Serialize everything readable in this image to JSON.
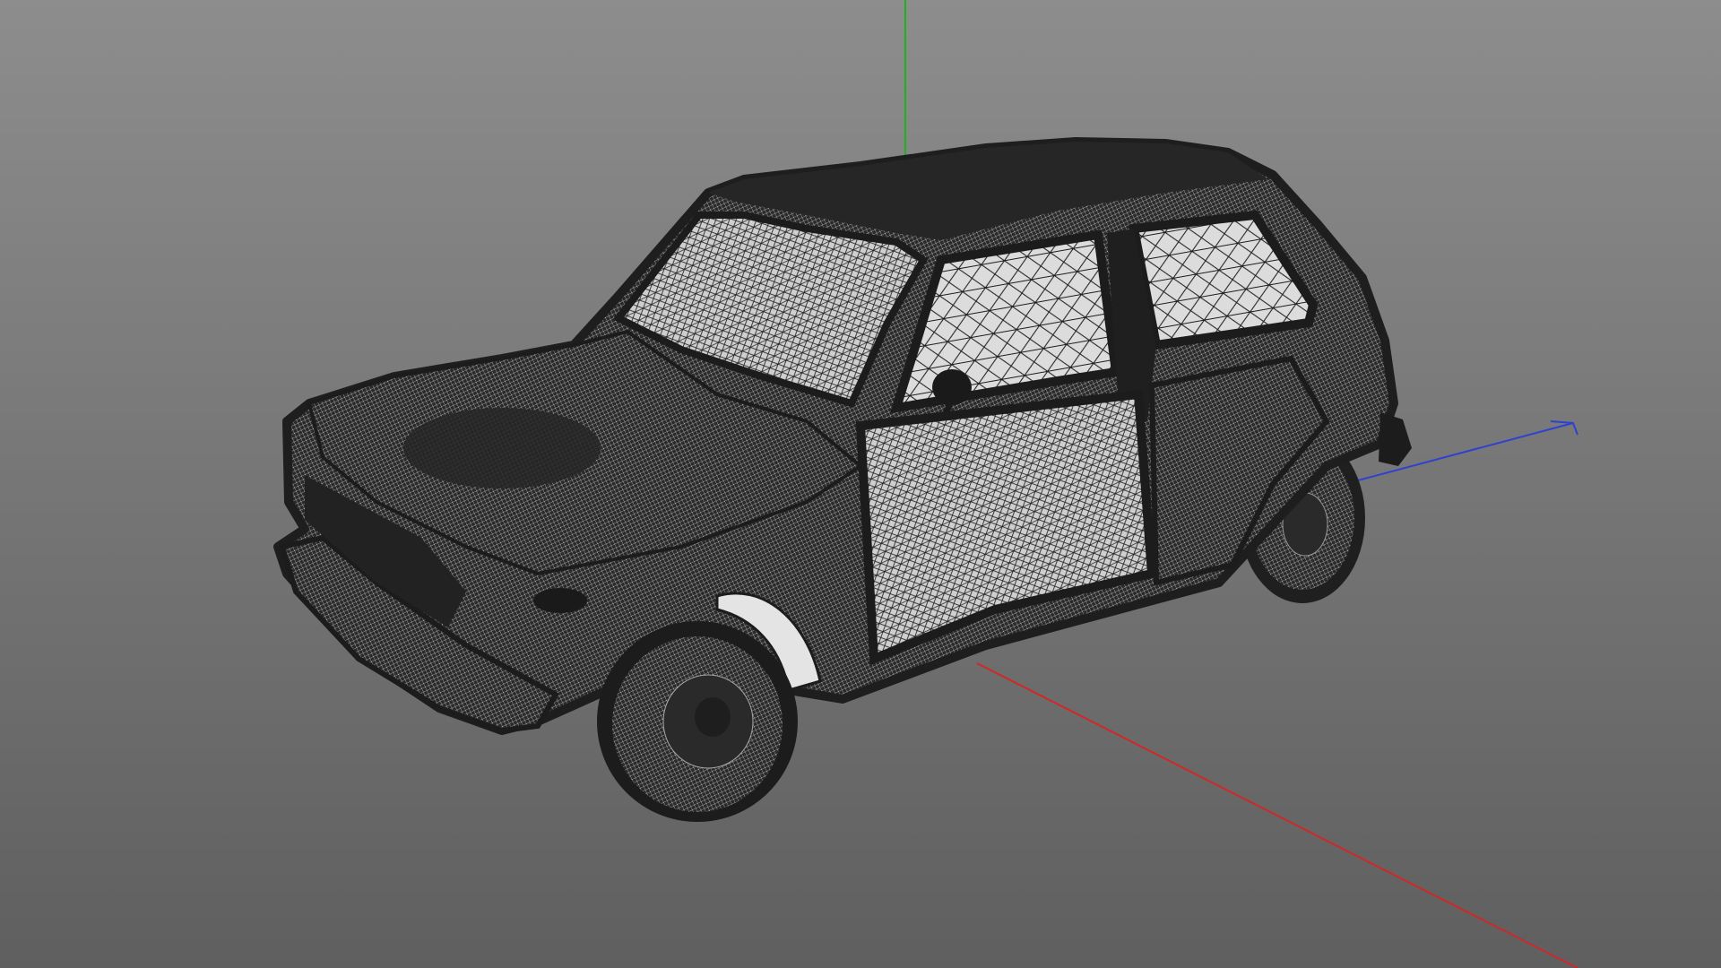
{
  "viewport": {
    "mode": "wireframe",
    "background_top": "#8d8d8d",
    "background_bottom": "#5f5f5f",
    "model": "hatchback-car",
    "mesh_color": "#232323",
    "mesh_light": "#e8e8e8"
  },
  "axes": {
    "x_color": "#d02828",
    "y_color": "#20b020",
    "z_color": "#3040d0"
  }
}
